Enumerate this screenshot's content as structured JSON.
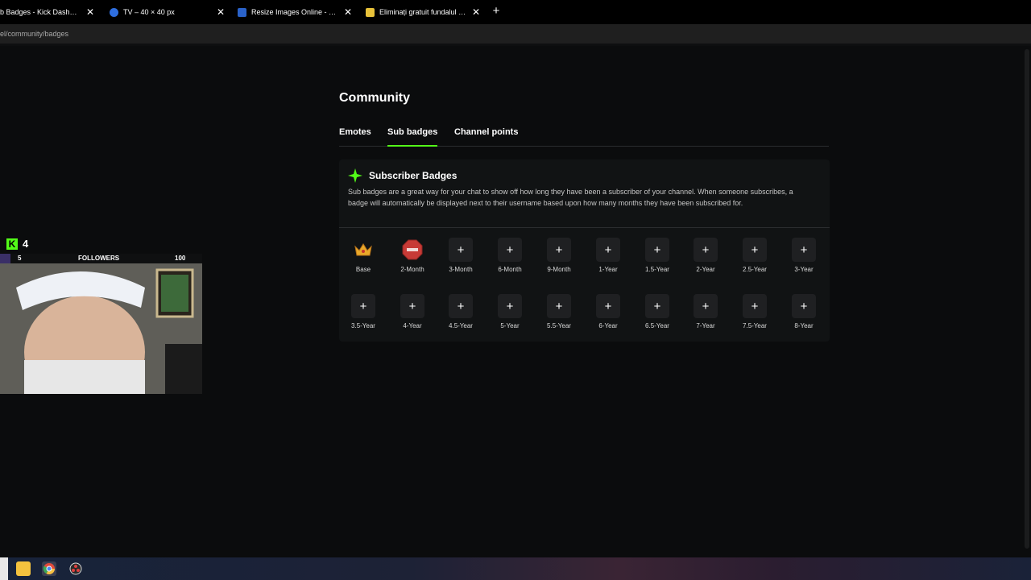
{
  "browser": {
    "tabs": [
      {
        "title": "b Badges - Kick Dashboard",
        "close": "✕"
      },
      {
        "title": "TV – 40 × 40 px",
        "close": "✕"
      },
      {
        "title": "Resize Images Online - Resize",
        "close": "✕"
      },
      {
        "title": "Eliminați gratuit fundalul dintr-",
        "close": "✕"
      }
    ],
    "new_tab": "+",
    "url": "el/community/badges"
  },
  "page": {
    "title": "Community",
    "tabs": [
      {
        "label": "Emotes"
      },
      {
        "label": "Sub badges"
      },
      {
        "label": "Channel points"
      }
    ],
    "active_tab": "Sub badges"
  },
  "panel": {
    "title": "Subscriber Badges",
    "description": "Sub badges are a great way for your chat to show off how long they have been a subscriber of your channel. When someone subscribes, a badge will automatically be displayed next to their username based upon how many months they have been subscribed for.",
    "add_symbol": "+",
    "badges": [
      {
        "label": "Base",
        "icon": "crown-icon"
      },
      {
        "label": "2-Month",
        "icon": "stop-sign-icon"
      },
      {
        "label": "3-Month"
      },
      {
        "label": "6-Month"
      },
      {
        "label": "9-Month"
      },
      {
        "label": "1-Year"
      },
      {
        "label": "1.5-Year"
      },
      {
        "label": "2-Year"
      },
      {
        "label": "2.5-Year"
      },
      {
        "label": "3-Year"
      },
      {
        "label": "3.5-Year"
      },
      {
        "label": "4-Year"
      },
      {
        "label": "4.5-Year"
      },
      {
        "label": "5-Year"
      },
      {
        "label": "5.5-Year"
      },
      {
        "label": "6-Year"
      },
      {
        "label": "6.5-Year"
      },
      {
        "label": "7-Year"
      },
      {
        "label": "7.5-Year"
      },
      {
        "label": "8-Year"
      }
    ]
  },
  "webcam_overlay": {
    "logo": "K",
    "count": "4",
    "progress_start": "5",
    "progress_label": "FOLLOWERS",
    "progress_goal": "100",
    "progress_fraction": 0.05
  },
  "colors": {
    "accent": "#53fc18",
    "background": "#0b0c0d",
    "panel": "#111314",
    "slot": "#1f2022"
  }
}
